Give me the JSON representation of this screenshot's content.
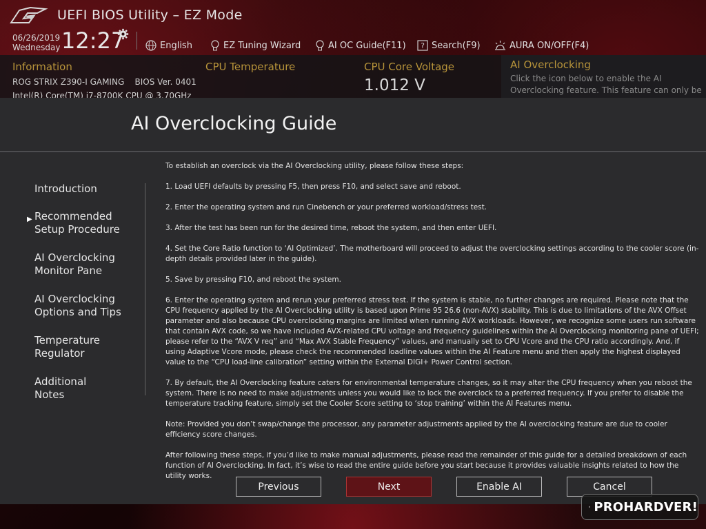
{
  "app": {
    "title": "UEFI BIOS Utility – EZ Mode"
  },
  "status": {
    "date": "06/26/2019",
    "day": "Wednesday",
    "time": "12:27"
  },
  "toolbar": {
    "language": "English",
    "ez_tuning": "EZ Tuning Wizard",
    "ai_oc_guide": "AI OC Guide(F11)",
    "search": "Search(F9)",
    "aura": "AURA ON/OFF(F4)"
  },
  "info": {
    "heading": "Information",
    "board": "ROG STRIX Z390-I GAMING    BIOS Ver. 0401",
    "cpu": "Intel(R) Core(TM) i7-8700K CPU @ 3.70GHz"
  },
  "cpu_temp": {
    "heading": "CPU Temperature"
  },
  "cpu_voltage": {
    "heading": "CPU Core Voltage",
    "value": "1.012 V"
  },
  "ai_panel": {
    "heading": "AI Overclocking",
    "description": "Click the icon below to enable the AI Overclocking feature.  This feature can only be"
  },
  "modal": {
    "title": "AI Overclocking Guide",
    "nav": [
      {
        "line1": "Introduction",
        "line2": ""
      },
      {
        "line1": "Recommended",
        "line2": "Setup Procedure"
      },
      {
        "line1": "AI Overclocking",
        "line2": "Monitor Pane"
      },
      {
        "line1": "AI Overclocking",
        "line2": "Options and Tips"
      },
      {
        "line1": "Temperature",
        "line2": "Regulator"
      },
      {
        "line1": "Additional",
        "line2": "Notes"
      }
    ],
    "paragraphs": [
      "To establish an overclock via the AI Overclocking utility, please follow these steps:",
      "1. Load UEFI defaults by pressing F5, then press F10, and select save and reboot.",
      "2. Enter the operating system and run Cinebench or your preferred workload/stress test.",
      "3. After the test has been run for the desired time, reboot the system, and then enter UEFI.",
      "4. Set the Core Ratio function to ‘AI Optimized’. The motherboard will proceed to adjust the overclocking settings according to the cooler score (in-depth details provided later in the guide).",
      "5. Save by pressing F10, and reboot the system.",
      "6. Enter the operating system and rerun your preferred stress test. If the system is stable, no further changes are required. Please note that the CPU frequency applied by the AI Overclocking utility is based upon Prime 95 26.6 (non-AVX) stability. This is due to limitations of the AVX Offset parameter and also because CPU overclocking margins are limited when running AVX workloads. However, we recognize some users run software that contain AVX code, so we have included AVX-related CPU voltage and frequency guidelines within the AI Overclocking monitoring pane of UEFI; please refer to the “AVX V req” and “Max AVX Stable Frequency” values, and manually set to CPU Vcore and the CPU ratio accordingly. And, if using Adaptive Vcore mode, please check the recommended loadline values within the AI Feature menu and then apply the highest displayed value to the “CPU load-line calibration” setting within the External DIGI+ Power Control section.",
      "7. By default, the AI Overclocking feature caters for environmental temperature changes, so it may alter the CPU frequency when you reboot the system. There is no need to make adjustments unless you would like to lock the overclock to a preferred frequency. If you prefer to disable the temperature tracking feature, simply set the Cooler Score setting to ‘stop training’ within the AI Features menu.",
      "Note: Provided you don’t swap/change the processor, any parameter adjustments applied by the AI overclocking feature are due to cooler efficiency score changes.",
      "After following these steps, if you’d like to make manual adjustments, please read the remainder of this guide for a detailed breakdown of each function of AI Overclocking. In fact, it’s wise to read the entire guide before you start because it provides valuable insights related to how the utility works."
    ],
    "buttons": {
      "previous": "Previous",
      "next": "Next",
      "enable_ai": "Enable AI",
      "cancel": "Cancel"
    }
  },
  "watermark": {
    "text": "PROHARDVER!"
  },
  "colors": {
    "accent_gold": "#b8943a",
    "primary_button": "#5e1317",
    "modal_bg": "#2b2b2d"
  }
}
